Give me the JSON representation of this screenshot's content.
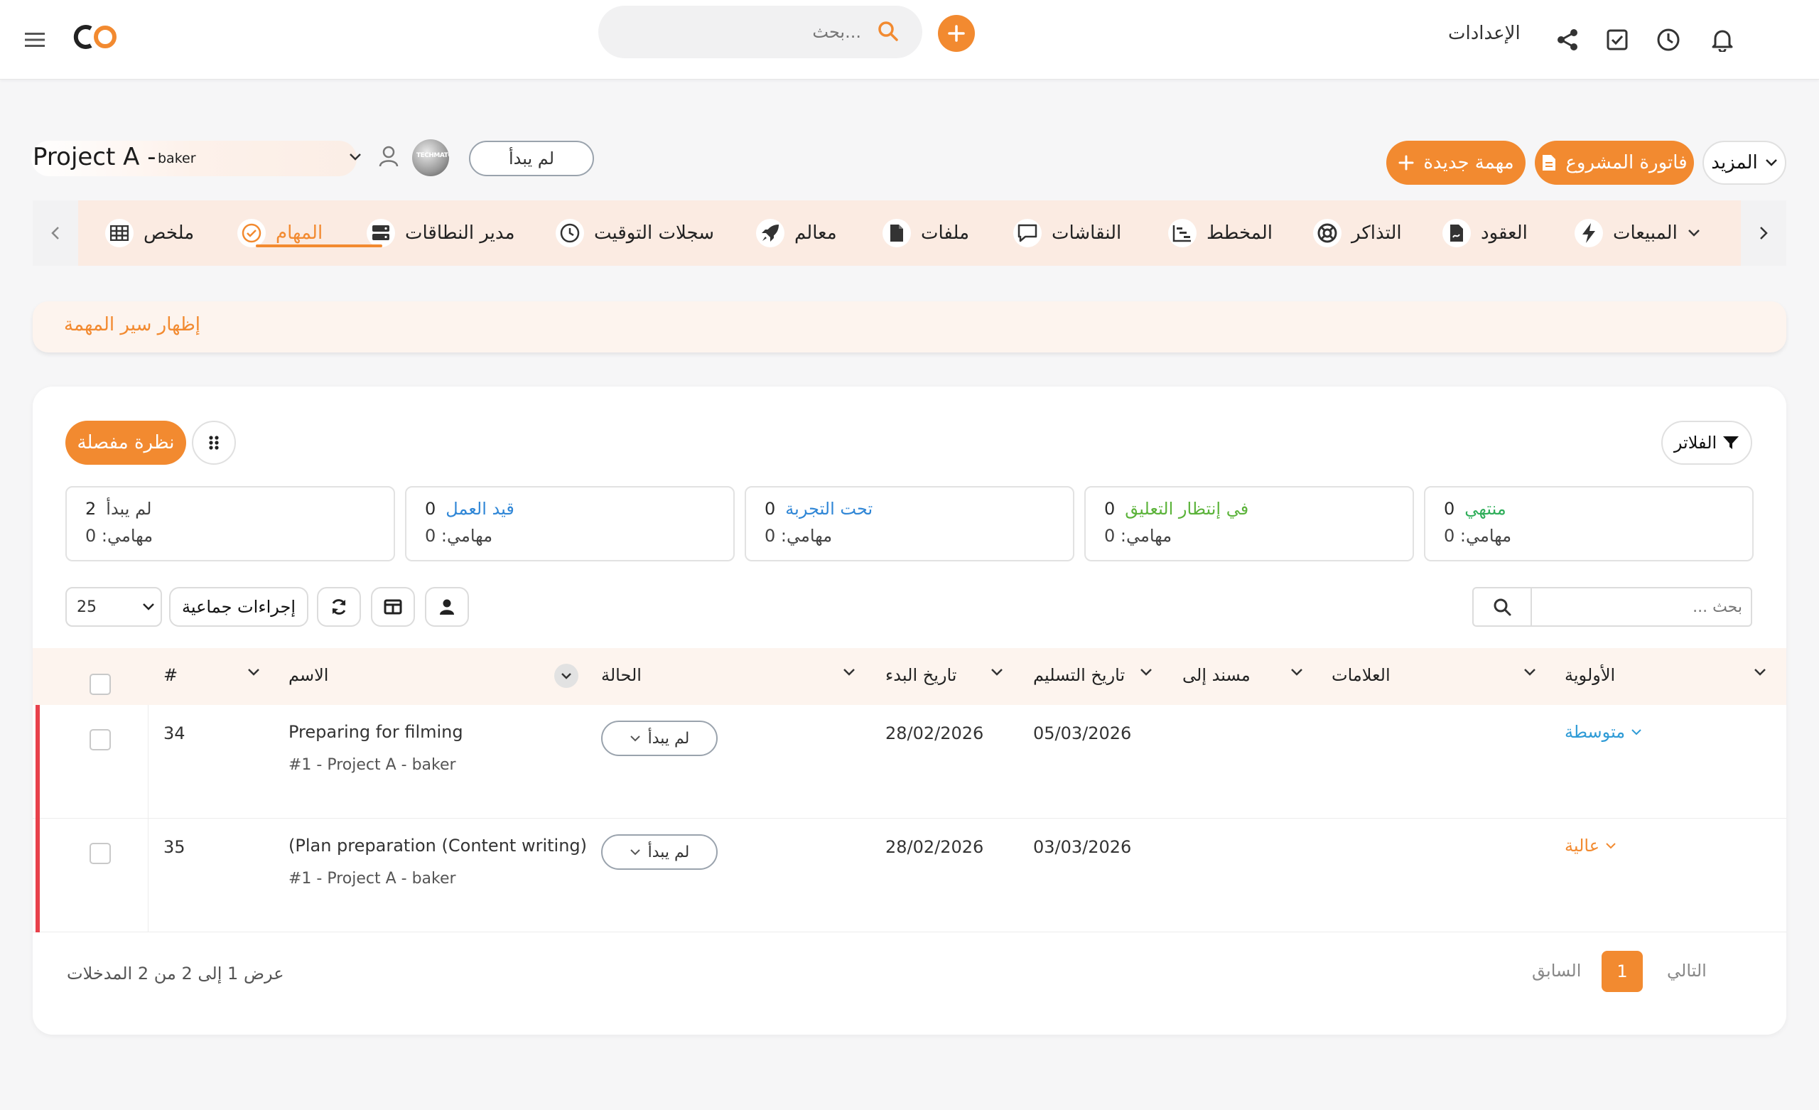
{
  "topbar": {
    "settings_label": "الإعدادات",
    "search_placeholder": "...بحث"
  },
  "project": {
    "name": "Project A -",
    "subtitle": "baker",
    "status": "لم يبدأ",
    "avatar_text": "TECHMATCH"
  },
  "actions": {
    "more": "المزيد",
    "invoice": "فاتورة المشروع",
    "new_task": "مهمة جديدة"
  },
  "tabs": [
    {
      "label": "ملخص",
      "icon": "table-icon"
    },
    {
      "label": "المهام",
      "icon": "check-circle-icon",
      "active": true
    },
    {
      "label": "مدير النطاقات",
      "icon": "server-icon"
    },
    {
      "label": "سجلات التوقيت",
      "icon": "clock-icon"
    },
    {
      "label": "معالم",
      "icon": "rocket-icon"
    },
    {
      "label": "ملفات",
      "icon": "file-icon"
    },
    {
      "label": "النقاشات",
      "icon": "comment-icon"
    },
    {
      "label": "المخطط",
      "icon": "gantt-icon"
    },
    {
      "label": "التذاكر",
      "icon": "lifebuoy-icon"
    },
    {
      "label": "العقود",
      "icon": "contract-icon"
    },
    {
      "label": "المبيعات",
      "icon": "bolt-icon"
    }
  ],
  "flow_bar_label": "إظهار سير المهمة",
  "panel": {
    "detailed_view": "نظرة مفصلة",
    "filters": "الفلاتر"
  },
  "stats": [
    {
      "label": "لم يبدأ",
      "count": "2",
      "mine": "مهامي: 0",
      "color": "#444444"
    },
    {
      "label": "قيد العمل",
      "count": "0",
      "mine": "مهامي: 0",
      "color": "#2f86d6"
    },
    {
      "label": "تحت التجربة",
      "count": "0",
      "mine": "مهامي: 0",
      "color": "#2f86d6"
    },
    {
      "label": "في إنتظار التعليق",
      "count": "0",
      "mine": "مهامي: 0",
      "color": "#5bb33a"
    },
    {
      "label": "منتهي",
      "count": "0",
      "mine": "مهامي: 0",
      "color": "#2fae5a"
    }
  ],
  "toolbar": {
    "page_size": "25",
    "bulk_actions": "إجراءات جماعية",
    "search_placeholder": "... بحث"
  },
  "table": {
    "headers": {
      "num": "#",
      "name": "الاسم",
      "status": "الحالة",
      "start": "تاريخ البدء",
      "due": "تاريخ التسليم",
      "assigned": "مسند إلى",
      "tags": "العلامات",
      "priority": "الأولوية"
    },
    "rows": [
      {
        "num": "34",
        "name": "Preparing for filming",
        "project": "#1 - Project A - baker",
        "status": "لم يبدأ",
        "start": "28/02/2026",
        "due": "05/03/2026",
        "priority": "متوسطة",
        "priority_color": "#2f9bd6"
      },
      {
        "num": "35",
        "name": "(Plan preparation (Content writing)",
        "project": "#1 - Project A - baker",
        "status": "لم يبدأ",
        "start": "28/02/2026",
        "due": "03/03/2026",
        "priority": "عالية",
        "priority_color": "#f28a30"
      }
    ]
  },
  "footer": {
    "info": "عرض 1 إلى 2 من 2 المدخلات",
    "prev": "السابق",
    "page": "1",
    "next": "التالي"
  },
  "colors": {
    "accent": "#f28a30",
    "row_marker": "#e8414b"
  }
}
